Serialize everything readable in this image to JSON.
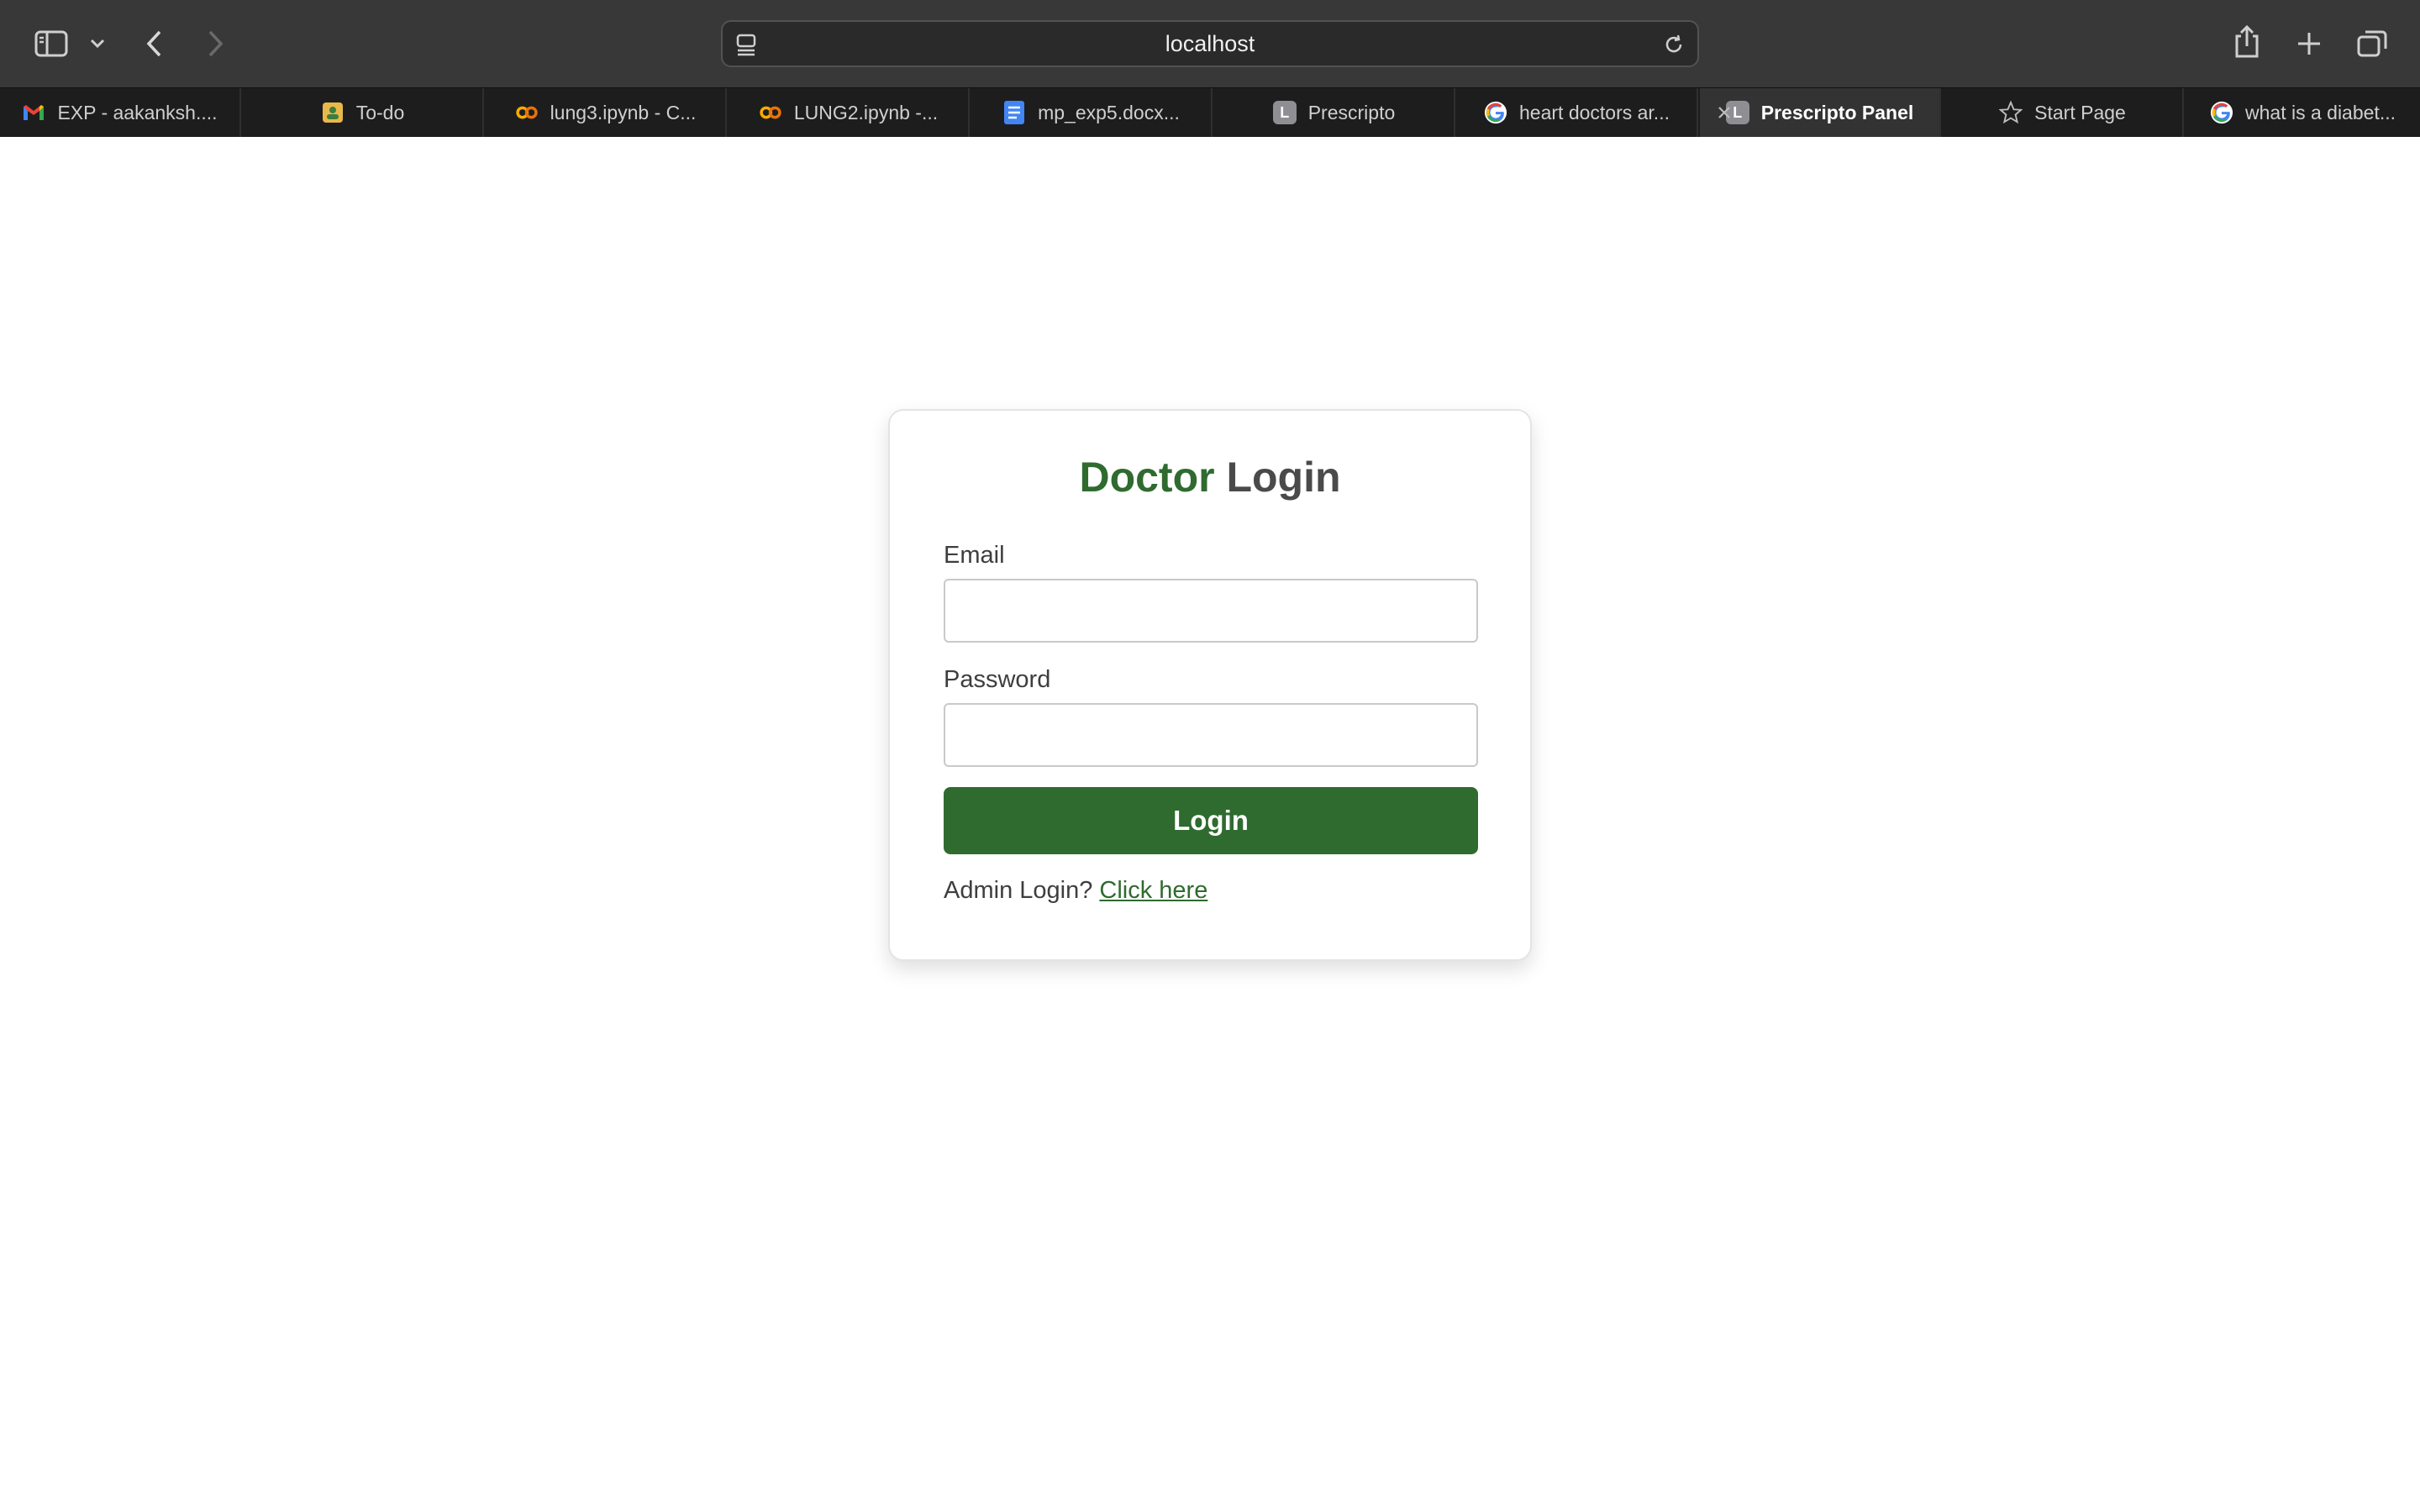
{
  "browser": {
    "address": "localhost",
    "tabs": [
      {
        "label": "EXP - aakanksh....",
        "icon": "gmail-icon"
      },
      {
        "label": "To-do",
        "icon": "todo-icon"
      },
      {
        "label": "lung3.ipynb - C...",
        "icon": "colab-icon"
      },
      {
        "label": "LUNG2.ipynb -...",
        "icon": "colab-icon"
      },
      {
        "label": "mp_exp5.docx...",
        "icon": "docs-icon"
      },
      {
        "label": "Prescripto",
        "icon": "letter-l-icon",
        "letter": "L"
      },
      {
        "label": "heart doctors ar...",
        "icon": "google-icon"
      },
      {
        "label": "Prescripto Panel",
        "icon": "letter-l-icon",
        "letter": "L",
        "active": true
      },
      {
        "label": "Start Page",
        "icon": "star-icon"
      },
      {
        "label": "what is a diabet...",
        "icon": "google-icon"
      }
    ]
  },
  "login": {
    "title_accent": "Doctor",
    "title_rest": " Login",
    "email_label": "Email",
    "email_value": "",
    "password_label": "Password",
    "password_value": "",
    "submit_label": "Login",
    "admin_prompt": "Admin Login? ",
    "admin_link": "Click here"
  },
  "colors": {
    "accent": "#2f6b2f",
    "toolbar": "#383838",
    "tabstrip": "#1d1d1d"
  }
}
